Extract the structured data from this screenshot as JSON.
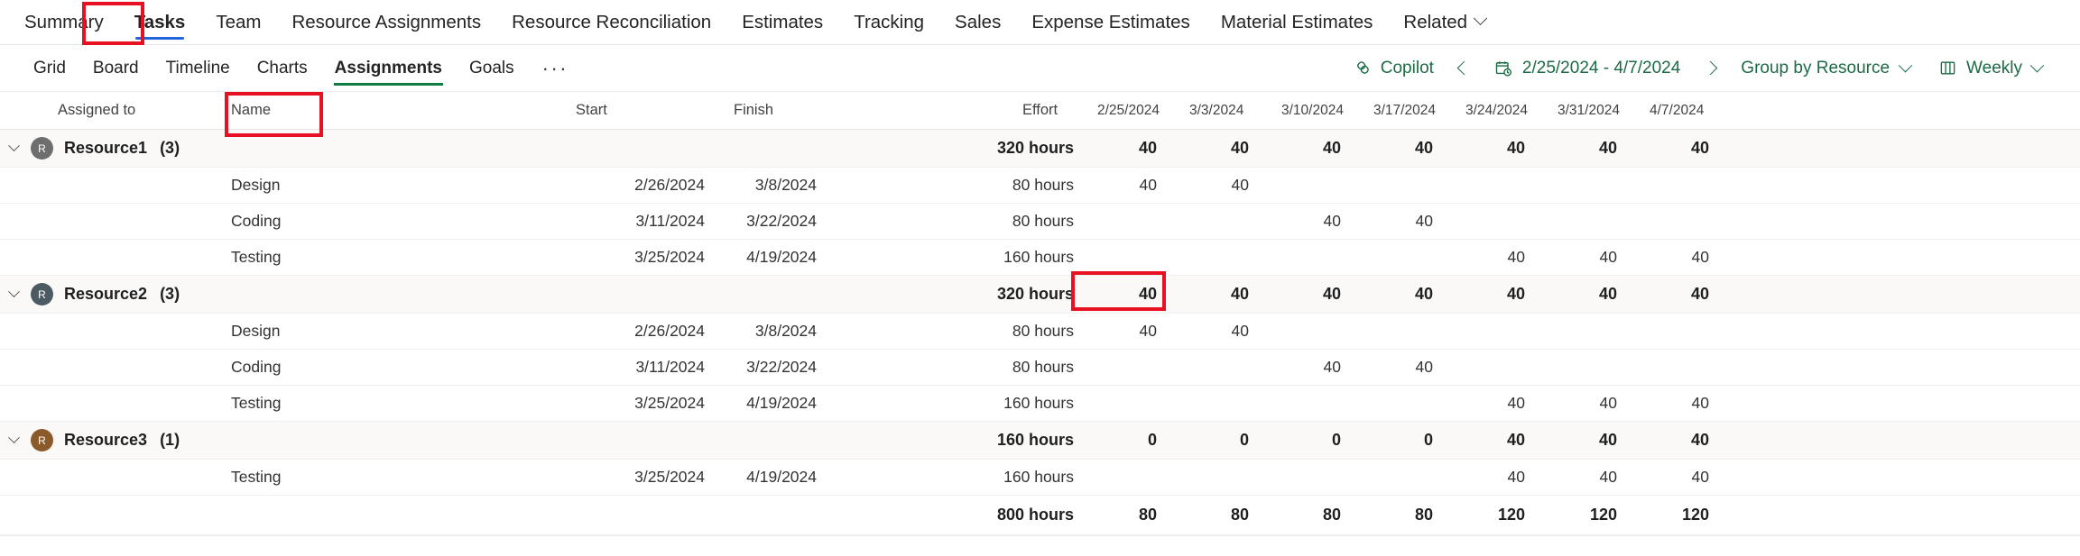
{
  "entity_nav": {
    "tabs": [
      {
        "label": "Summary",
        "selected": false
      },
      {
        "label": "Tasks",
        "selected": true
      },
      {
        "label": "Team",
        "selected": false
      },
      {
        "label": "Resource Assignments",
        "selected": false
      },
      {
        "label": "Resource Reconciliation",
        "selected": false
      },
      {
        "label": "Estimates",
        "selected": false
      },
      {
        "label": "Tracking",
        "selected": false
      },
      {
        "label": "Sales",
        "selected": false
      },
      {
        "label": "Expense Estimates",
        "selected": false
      },
      {
        "label": "Material Estimates",
        "selected": false
      },
      {
        "label": "Related",
        "selected": false,
        "has_chevron": true
      }
    ]
  },
  "command_bar": {
    "views": [
      {
        "label": "Grid",
        "selected": false
      },
      {
        "label": "Board",
        "selected": false
      },
      {
        "label": "Timeline",
        "selected": false
      },
      {
        "label": "Charts",
        "selected": false
      },
      {
        "label": "Assignments",
        "selected": true
      },
      {
        "label": "Goals",
        "selected": false
      }
    ],
    "overflow_label": "···",
    "copilot_label": "Copilot",
    "copilot_icon": "copilot-icon",
    "prev_icon": "chevron-left-icon",
    "next_icon": "chevron-right-icon",
    "calendar_icon": "calendar-clock-icon",
    "date_range": "2/25/2024 - 4/7/2024",
    "group_by_label": "Group by Resource",
    "group_by_icon": "chevron-down-icon",
    "period_icon": "columns-icon",
    "period_label": "Weekly",
    "period_chevron_icon": "chevron-down-icon"
  },
  "grid": {
    "columns": {
      "assigned_to": "Assigned to",
      "name": "Name",
      "start": "Start",
      "finish": "Finish",
      "effort": "Effort"
    },
    "week_headers": [
      "2/25/2024",
      "3/3/2024",
      "3/10/2024",
      "3/17/2024",
      "3/24/2024",
      "3/31/2024",
      "4/7/2024"
    ],
    "groups": [
      {
        "name": "Resource1",
        "count": "(3)",
        "avatar_initial": "R",
        "avatar_color": "#6e6e6e",
        "effort": "320 hours",
        "weeks": [
          "40",
          "40",
          "40",
          "40",
          "40",
          "40",
          "40"
        ],
        "tasks": [
          {
            "name": "Design",
            "start": "2/26/2024",
            "finish": "3/8/2024",
            "effort": "80 hours",
            "weeks": [
              "40",
              "40",
              "",
              "",
              "",
              "",
              ""
            ]
          },
          {
            "name": "Coding",
            "start": "3/11/2024",
            "finish": "3/22/2024",
            "effort": "80 hours",
            "weeks": [
              "",
              "",
              "40",
              "40",
              "",
              "",
              ""
            ]
          },
          {
            "name": "Testing",
            "start": "3/25/2024",
            "finish": "4/19/2024",
            "effort": "160 hours",
            "weeks": [
              "",
              "",
              "",
              "",
              "40",
              "40",
              "40"
            ]
          }
        ]
      },
      {
        "name": "Resource2",
        "count": "(3)",
        "avatar_initial": "R",
        "avatar_color": "#4c5b63",
        "effort": "320 hours",
        "weeks": [
          "40",
          "40",
          "40",
          "40",
          "40",
          "40",
          "40"
        ],
        "tasks": [
          {
            "name": "Design",
            "start": "2/26/2024",
            "finish": "3/8/2024",
            "effort": "80 hours",
            "weeks": [
              "40",
              "40",
              "",
              "",
              "",
              "",
              ""
            ]
          },
          {
            "name": "Coding",
            "start": "3/11/2024",
            "finish": "3/22/2024",
            "effort": "80 hours",
            "weeks": [
              "",
              "",
              "40",
              "40",
              "",
              "",
              ""
            ]
          },
          {
            "name": "Testing",
            "start": "3/25/2024",
            "finish": "4/19/2024",
            "effort": "160 hours",
            "weeks": [
              "",
              "",
              "",
              "",
              "40",
              "40",
              "40"
            ]
          }
        ]
      },
      {
        "name": "Resource3",
        "count": "(1)",
        "avatar_initial": "R",
        "avatar_color": "#8a5a2b",
        "effort": "160 hours",
        "weeks": [
          "0",
          "0",
          "0",
          "0",
          "40",
          "40",
          "40"
        ],
        "tasks": [
          {
            "name": "Testing",
            "start": "3/25/2024",
            "finish": "4/19/2024",
            "effort": "160 hours",
            "weeks": [
              "",
              "",
              "",
              "",
              "40",
              "40",
              "40"
            ]
          }
        ]
      }
    ],
    "total_row": {
      "effort": "800 hours",
      "weeks": [
        "80",
        "80",
        "80",
        "80",
        "120",
        "120",
        "120"
      ]
    }
  },
  "annotations": {
    "accent_red": "#e81123",
    "boxes": [
      {
        "name": "tasks-tab-highlight"
      },
      {
        "name": "assignments-view-highlight"
      },
      {
        "name": "design-week2-cell-highlight"
      }
    ]
  }
}
